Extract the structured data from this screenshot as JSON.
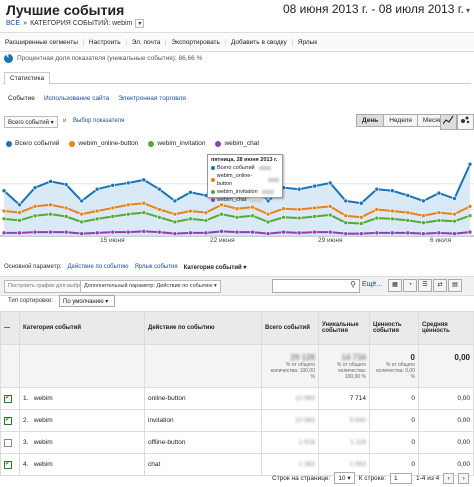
{
  "header": {
    "title": "Лучшие события",
    "date_range": "08 июня 2013 г. - 08 июля 2013 г."
  },
  "breadcrumb": {
    "root": "ВСЕ",
    "sep": "»",
    "current": "КАТЕГОРИЯ СОБЫТИЙ: webim"
  },
  "toolbar": [
    "Расширенные сегменты",
    "Настроить",
    "Эл. почта",
    "Экспортировать",
    "Добавить в сводку",
    "Ярлык"
  ],
  "sample_pct": "Процентная доля показателя (уникальные события): 86,66 %",
  "stats_tab": "Статистика",
  "subtabs": {
    "active": "Событие",
    "usage": "Использование сайта",
    "ecommerce": "Электронная торговля"
  },
  "metric_select": "Всего событий",
  "vs_label": "и",
  "pick_metric": "Выбор показателя",
  "period_buttons": {
    "day": "День",
    "week": "Неделя",
    "month": "Месяц"
  },
  "icons": {
    "line_chart": "line-chart-icon",
    "scatter": "scatter-icon"
  },
  "colors": {
    "total": "#1a73b8",
    "online": "#e8831a",
    "invitation": "#58a83a",
    "chat": "#8e3fb3",
    "area": "#cfe3f4",
    "accent_link": "#1a4fa0"
  },
  "legend": [
    "Всего событий",
    "webim_online-button",
    "webim_invitation",
    "webim_chat"
  ],
  "tooltip": {
    "title": "пятница, 28 июня 2013 г.",
    "rows": [
      {
        "label": "Всего событий",
        "color": "#1a73b8"
      },
      {
        "label": "webim_online-button",
        "color": "#e8831a"
      },
      {
        "label": "webim_invitation",
        "color": "#58a83a"
      },
      {
        "label": "webim_chat",
        "color": "#8e3fb3"
      }
    ]
  },
  "chart_data": {
    "type": "line",
    "x_ticks": [
      "15 июня",
      "22 июня",
      "29 июня",
      "6 июля"
    ],
    "series": [
      {
        "name": "Всего событий",
        "values": [
          58,
          40,
          62,
          70,
          66,
          45,
          60,
          65,
          68,
          72,
          60,
          45,
          56,
          52,
          75,
          65,
          70,
          45,
          62,
          60,
          64,
          68,
          45,
          42,
          60,
          58,
          52,
          45,
          55,
          48,
          92
        ]
      },
      {
        "name": "webim_online-button",
        "values": [
          32,
          30,
          38,
          40,
          36,
          28,
          32,
          36,
          40,
          42,
          34,
          28,
          32,
          30,
          40,
          35,
          37,
          28,
          35,
          34,
          36,
          38,
          26,
          24,
          34,
          32,
          30,
          26,
          30,
          28,
          38
        ]
      },
      {
        "name": "webim_invitation",
        "values": [
          22,
          20,
          26,
          28,
          25,
          18,
          22,
          25,
          28,
          30,
          24,
          18,
          22,
          20,
          28,
          24,
          26,
          18,
          24,
          23,
          25,
          27,
          17,
          16,
          23,
          22,
          20,
          17,
          20,
          19,
          26
        ]
      },
      {
        "name": "webim_chat",
        "values": [
          4,
          4,
          5,
          5,
          5,
          3,
          4,
          5,
          5,
          6,
          5,
          3,
          4,
          4,
          6,
          5,
          5,
          3,
          5,
          4,
          5,
          5,
          3,
          3,
          4,
          4,
          4,
          3,
          4,
          3,
          5
        ]
      }
    ],
    "grid": true
  },
  "dimension": {
    "label": "Основной параметр:",
    "opt1": "Действие по событию",
    "opt2": "Ярлык события",
    "opt3": "Категория событий"
  },
  "controls": {
    "plot_rows": "Построить график для выбранных строк",
    "secondary": "Дополнительный параметр: Действие по событию",
    "more": "Ещё...",
    "sort_label": "Тип сортировки:",
    "sort_value": "По умолчанию"
  },
  "table": {
    "headers": [
      "Категория событий",
      "Действие по событию",
      "Всего событий",
      "Уникальные события",
      "Ценность события",
      "Средняя ценность"
    ],
    "totals": {
      "total": "29 128",
      "total_pct": "% от общего количества: 100,00 %",
      "unique": "14 734",
      "unique_pct": "% от общего количества: 100,00 %",
      "value": "0",
      "value_pct": "% от общего количества: 0,00 %",
      "avg": "0,00"
    },
    "rows": [
      {
        "n": "1.",
        "cat": "webim",
        "action": "online-button",
        "total": "12 960",
        "unique": "7 714",
        "value": "0",
        "avg": "0,00",
        "checked": true
      },
      {
        "n": "2.",
        "cat": "webim",
        "action": "invitation",
        "total": "10 583",
        "unique": "5 640",
        "value": "0",
        "avg": "0,00",
        "checked": true
      },
      {
        "n": "3.",
        "cat": "webim",
        "action": "offline-button",
        "total": "1 618",
        "unique": "1 118",
        "value": "0",
        "avg": "0,00",
        "checked": false
      },
      {
        "n": "4.",
        "cat": "webim",
        "action": "chat",
        "total": "1 363",
        "unique": "1 063",
        "value": "0",
        "avg": "0,00",
        "checked": true
      }
    ]
  },
  "pager": {
    "rows_label": "Строк на странице:",
    "rows_value": "10",
    "goto_label": "К строке:",
    "goto_value": "1",
    "range": "1-4 из 4"
  }
}
